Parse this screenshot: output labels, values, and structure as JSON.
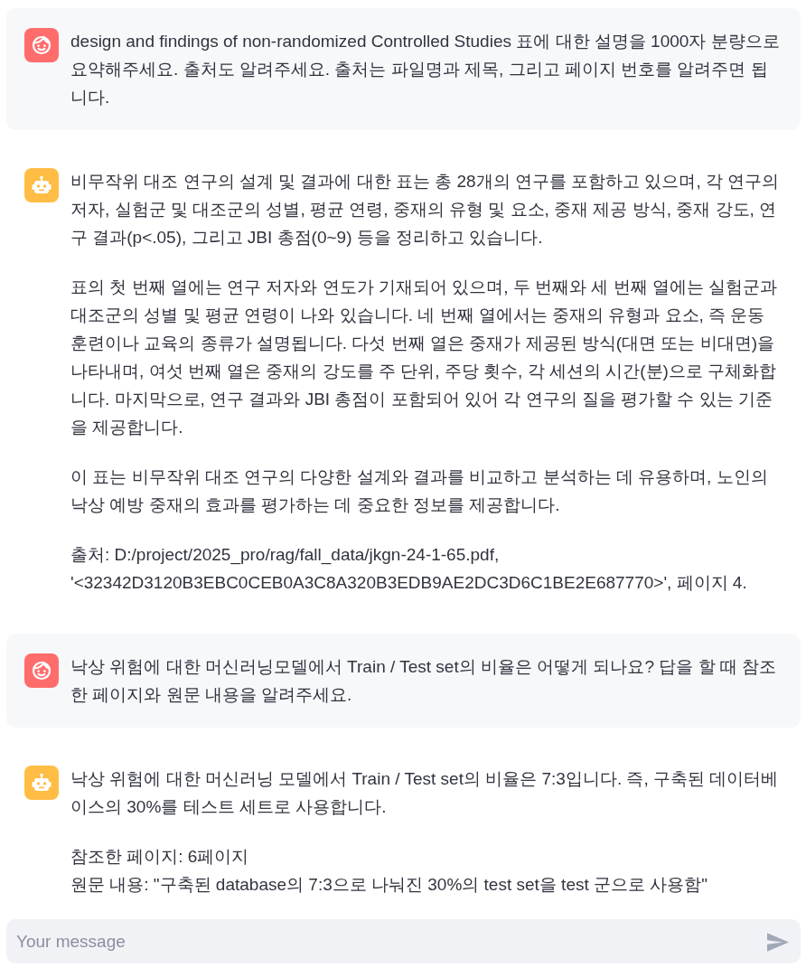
{
  "messages": [
    {
      "kind": "user",
      "paragraphs": [
        [
          "design and findings of non-randomized Controlled Studies 표에 대한 설명을 1000자 분량으로 요약해주세요. 출처도 알려주세요. 출처는 파일명과 제목, 그리고 페이지 번호를 알려주면 됩니다."
        ]
      ]
    },
    {
      "kind": "assistant",
      "paragraphs": [
        [
          "비무작위 대조 연구의 설계 및 결과에 대한 표는 총 28개의 연구를 포함하고 있으며, 각 연구의 저자, 실험군 및 대조군의 성별, 평균 연령, 중재의 유형 및 요소, 중재 제공 방식, 중재 강도, 연구 결과(p<.05), 그리고 JBI 총점(0~9) 등을 정리하고 있습니다."
        ],
        [
          "표의 첫 번째 열에는 연구 저자와 연도가 기재되어 있으며, 두 번째와 세 번째 열에는 실험군과 대조군의 성별 및 평균 연령이 나와 있습니다. 네 번째 열에서는 중재의 유형과 요소, 즉 운동 훈련이나 교육의 종류가 설명됩니다. 다섯 번째 열은 중재가 제공된 방식(대면 또는 비대면)을 나타내며, 여섯 번째 열은 중재의 강도를 주 단위, 주당 횟수, 각 세션의 시간(분)으로 구체화합니다. 마지막으로, 연구 결과와 JBI 총점이 포함되어 있어 각 연구의 질을 평가할 수 있는 기준을 제공합니다."
        ],
        [
          "이 표는 비무작위 대조 연구의 다양한 설계와 결과를 비교하고 분석하는 데 유용하며, 노인의 낙상 예방 중재의 효과를 평가하는 데 중요한 정보를 제공합니다."
        ],
        [
          "출처: D:/project/2025_pro/rag/fall_data/jkgn-24-1-65.pdf, '<32342D3120B3EBC0CEB0A3C8A320B3EDB9AE2DC3D6C1BE2E687770>', 페이지 4."
        ]
      ]
    },
    {
      "kind": "user",
      "paragraphs": [
        [
          "낙상 위험에 대한 머신러닝모델에서 Train / Test set의 비율은 어떻게 되나요? 답을 할 때 참조한 페이지와 원문 내용을 알려주세요."
        ]
      ]
    },
    {
      "kind": "assistant",
      "paragraphs": [
        [
          "낙상 위험에 대한 머신러닝 모델에서 Train / Test set의 비율은 7:3입니다. 즉, 구축된 데이터베이스의 30%를 테스트 세트로 사용합니다."
        ],
        [
          "참조한 페이지: 6페이지",
          "원문 내용: \"구축된 database의 7:3으로 나눠진 30%의 test set을 test 군으로 사용함\""
        ]
      ]
    }
  ],
  "chat_input": {
    "placeholder": "Your message"
  }
}
